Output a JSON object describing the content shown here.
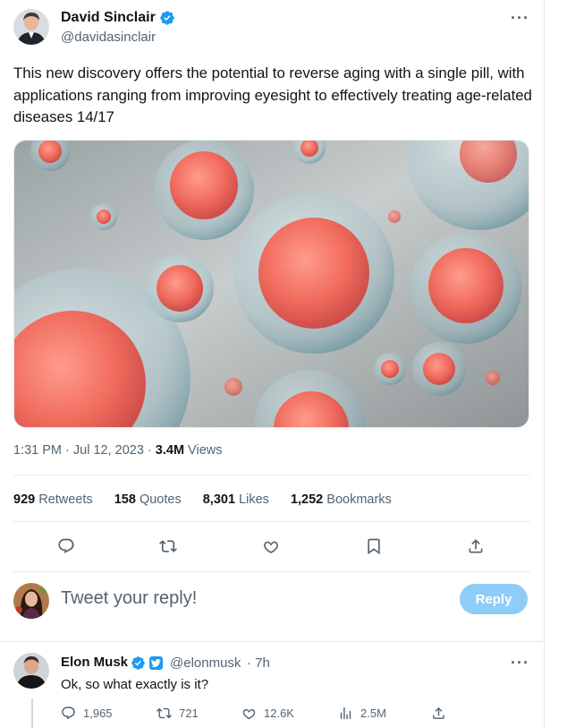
{
  "tweet": {
    "author": {
      "name": "David Sinclair",
      "handle": "@davidasinclair"
    },
    "text": "This new discovery offers the potential to reverse aging with a single pill, with applications ranging from improving eyesight to effectively treating age-related diseases 14/17",
    "time": "1:31 PM · Jul 12, 2023 · ",
    "views_count": "3.4M",
    "views_label": " Views",
    "stats": {
      "retweets_count": "929",
      "retweets_label": "Retweets",
      "quotes_count": "158",
      "quotes_label": "Quotes",
      "likes_count": "8,301",
      "likes_label": "Likes",
      "bookmarks_count": "1,252",
      "bookmarks_label": "Bookmarks"
    },
    "more_label": "···",
    "icons": [
      "reply-icon",
      "retweet-icon",
      "like-icon",
      "bookmark-icon",
      "share-icon"
    ]
  },
  "reply_box": {
    "placeholder": "Tweet your reply!",
    "button_label": "Reply"
  },
  "reply": {
    "author": {
      "name": "Elon Musk",
      "handle": "@elonmusk",
      "time": "· 7h"
    },
    "text": "Ok, so what exactly is it?",
    "more_label": "···",
    "stats": {
      "replies": "1,965",
      "retweets": "721",
      "likes": "12.6K",
      "views": "2.5M"
    }
  },
  "colors": {
    "accent": "#1d9bf0",
    "muted": "#536471",
    "reply_button": "#8ecdf8",
    "gold_badge": "#e2b719"
  }
}
